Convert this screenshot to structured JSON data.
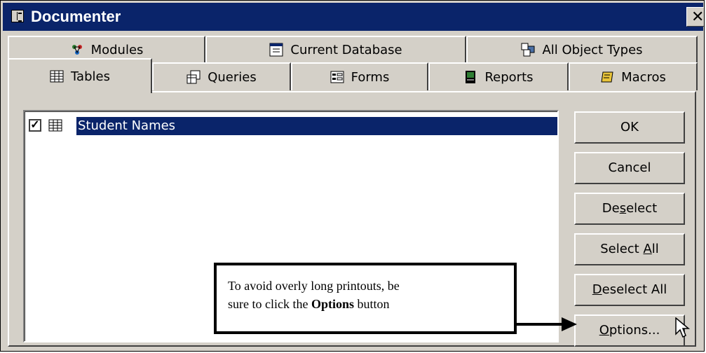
{
  "window": {
    "title": "Documenter",
    "close_glyph": "✕",
    "icon": "documenter-form-icon"
  },
  "tabs": {
    "back_row": [
      {
        "label": "Modules",
        "icon": "modules-icon"
      },
      {
        "label": "Current Database",
        "icon": "current-database-icon"
      },
      {
        "label": "All Object Types",
        "icon": "all-object-types-icon"
      }
    ],
    "front_row": [
      {
        "label": "Tables",
        "icon": "table-icon",
        "active": true
      },
      {
        "label": "Queries",
        "icon": "query-icon"
      },
      {
        "label": "Forms",
        "icon": "form-icon"
      },
      {
        "label": "Reports",
        "icon": "report-icon"
      },
      {
        "label": "Macros",
        "icon": "macro-icon"
      }
    ]
  },
  "list": {
    "items": [
      {
        "label": "Student Names",
        "checked": true,
        "selected": true,
        "check_glyph": "✓"
      }
    ]
  },
  "buttons": {
    "ok": {
      "label": "OK"
    },
    "cancel": {
      "label": "Cancel"
    },
    "deselect": {
      "pre": "De",
      "accel": "s",
      "post": "elect"
    },
    "select_all": {
      "pre": "Select ",
      "accel": "A",
      "post": "ll"
    },
    "deselect_all": {
      "pre": "",
      "accel": "D",
      "post": "eselect All"
    },
    "options": {
      "pre": "",
      "accel": "O",
      "post": "ptions..."
    }
  },
  "callout": {
    "line1": "To avoid overly long printouts, be",
    "line2_pre": "sure to click the ",
    "line2_bold": "Options",
    "line2_post": " button"
  },
  "colors": {
    "face": "#d4d0c8",
    "titlebar": "#0a246a",
    "selection": "#0a246a"
  }
}
